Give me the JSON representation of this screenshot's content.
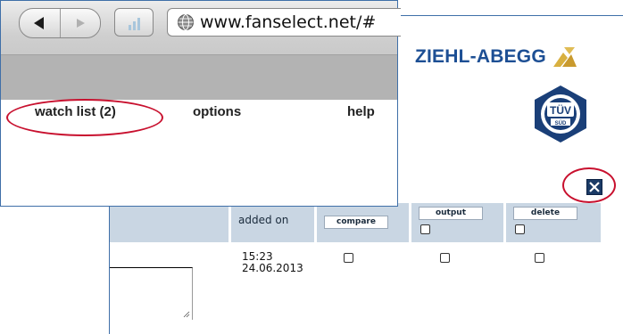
{
  "browser": {
    "url": "www.fanselect.net/#"
  },
  "menu": {
    "watch_list": "watch list (2)",
    "options": "options",
    "help": "help"
  },
  "brand": {
    "logo_text": "ZIEHL-ABEGG",
    "certification": "TÜV SÜD",
    "logo_color": "#1d4f94",
    "accent_color": "#d8b040"
  },
  "table": {
    "headers": {
      "added_on": "added on",
      "compare": "compare",
      "output": "output",
      "delete": "delete"
    },
    "rows": [
      {
        "time": "15:23",
        "date": "24.06.2013"
      }
    ]
  },
  "colors": {
    "header_bg": "#c9d6e3",
    "highlight": "#c8102e"
  }
}
